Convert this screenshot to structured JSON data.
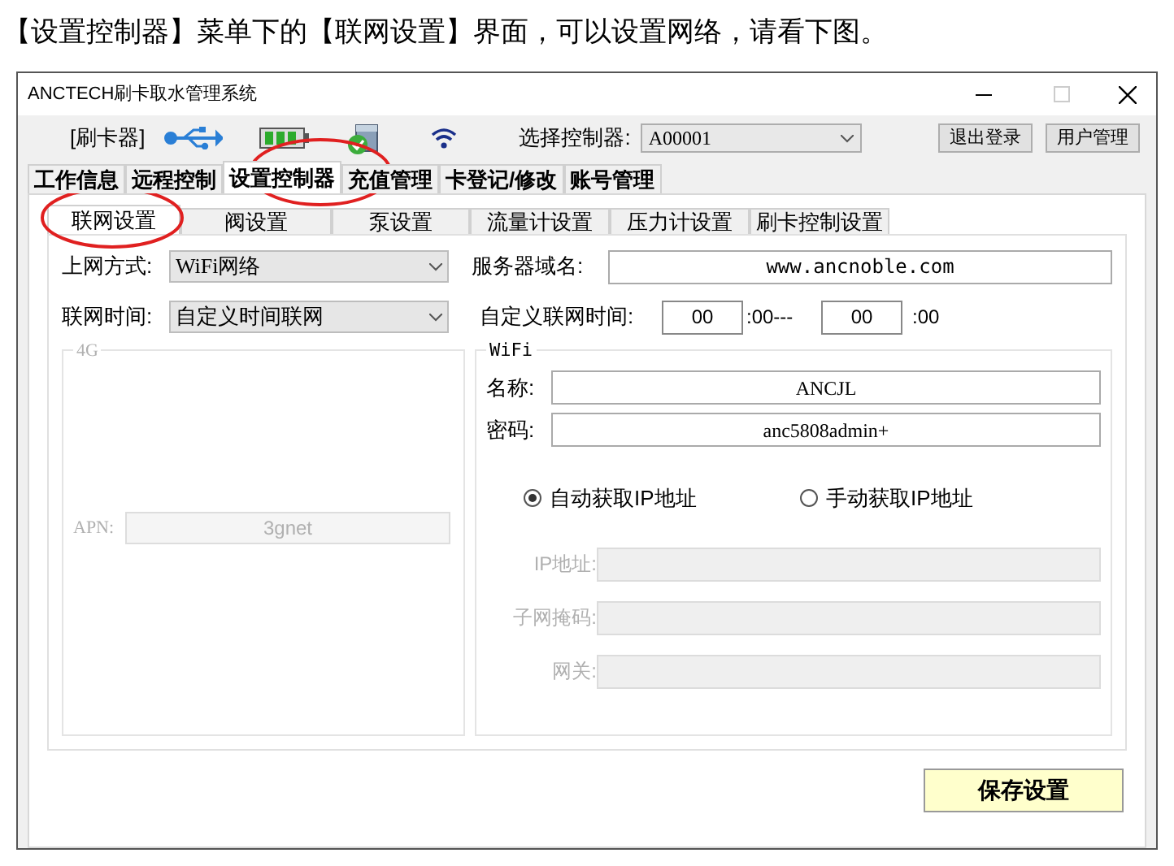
{
  "caption": "【设置控制器】菜单下的【联网设置】界面，可以设置网络，请看下图。",
  "window": {
    "title": "ANCTECH刷卡取水管理系统"
  },
  "toolbar": {
    "reader_label": "[刷卡器]",
    "controller_label": "选择控制器:",
    "controller_value": "A00001",
    "buttons": [
      "退出登录",
      "用户管理"
    ]
  },
  "main_tabs": [
    {
      "label": "工作信息",
      "selected": false
    },
    {
      "label": "远程控制",
      "selected": false
    },
    {
      "label": "设置控制器",
      "selected": true
    },
    {
      "label": "充值管理",
      "selected": false
    },
    {
      "label": "卡登记/修改",
      "selected": false
    },
    {
      "label": "账号管理",
      "selected": false
    }
  ],
  "sub_tabs": [
    {
      "label": "联网设置",
      "selected": true
    },
    {
      "label": "阀设置",
      "selected": false
    },
    {
      "label": "泵设置",
      "selected": false
    },
    {
      "label": "流量计设置",
      "selected": false
    },
    {
      "label": "压力计设置",
      "selected": false
    },
    {
      "label": "刷卡控制设置",
      "selected": false
    }
  ],
  "network": {
    "mode_label": "上网方式:",
    "mode_value": "WiFi网络",
    "server_label": "服务器域名:",
    "server_value": "www.ancnoble.com",
    "time_label": "联网时间:",
    "time_value": "自定义时间联网",
    "custom_time_label": "自定义联网时间:",
    "start_hour": "00",
    "start_suffix": ":00---",
    "end_hour": "00",
    "end_suffix": ":00"
  },
  "group_4g": {
    "title": "4G",
    "disabled": true,
    "apn_label": "APN:",
    "apn_value": "3gnet"
  },
  "wifi": {
    "title": "WiFi",
    "name_label": "名称:",
    "name_value": "ANCJL",
    "password_label": "密码:",
    "password_value": "anc5808admin+",
    "ip_modes": [
      {
        "label": "自动获取IP地址",
        "selected": true
      },
      {
        "label": "手动获取IP地址",
        "selected": false
      }
    ],
    "ip_fields": [
      {
        "label": "IP地址:",
        "disabled": true
      },
      {
        "label": "子网掩码:",
        "disabled": true
      },
      {
        "label": "网关:",
        "disabled": true
      }
    ]
  },
  "save_button": "保存设置"
}
